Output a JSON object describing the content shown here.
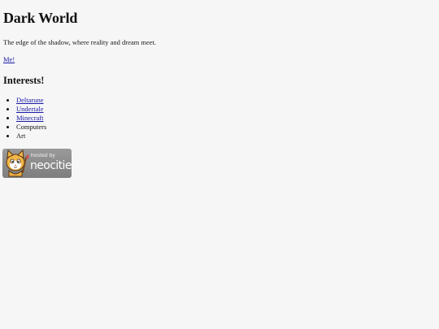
{
  "header": {
    "title": "Dark World",
    "tagline": "The edge of the shadow, where reality and dream meet."
  },
  "links": {
    "me": "Me!"
  },
  "interests": {
    "heading": "Interests!",
    "items": [
      {
        "label": "Deltarune",
        "link": true
      },
      {
        "label": "Undertale",
        "link": true
      },
      {
        "label": "Minecraft",
        "link": true
      },
      {
        "label": "Computers",
        "link": false
      },
      {
        "label": "Art",
        "link": false
      }
    ]
  },
  "badge": {
    "top_text": "hosted by",
    "brand_text": "neocities",
    "icon": "neocities-cat-icon"
  },
  "colors": {
    "background": "#f6f6f6",
    "link": "#1a1aa6",
    "badge": "#8a8a8a"
  }
}
